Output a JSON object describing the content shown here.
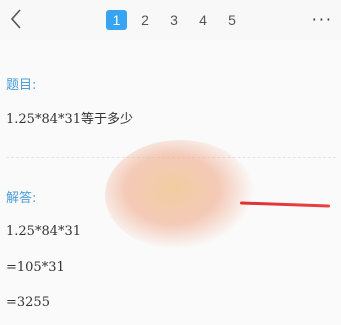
{
  "header": {
    "pages": [
      "1",
      "2",
      "3",
      "4",
      "5"
    ],
    "active_page": "1",
    "more": "···"
  },
  "question": {
    "label": "题目:",
    "text": "1.25*84*31等于多少"
  },
  "answer": {
    "label": "解答:",
    "steps": [
      "1.25*84*31",
      "=105*31",
      "=3255"
    ]
  },
  "colors": {
    "accent": "#36a4f2",
    "label": "#4a9ed8",
    "text": "#333333"
  },
  "icons": {
    "back": "chevron-left-icon",
    "more": "more-dots-icon"
  }
}
